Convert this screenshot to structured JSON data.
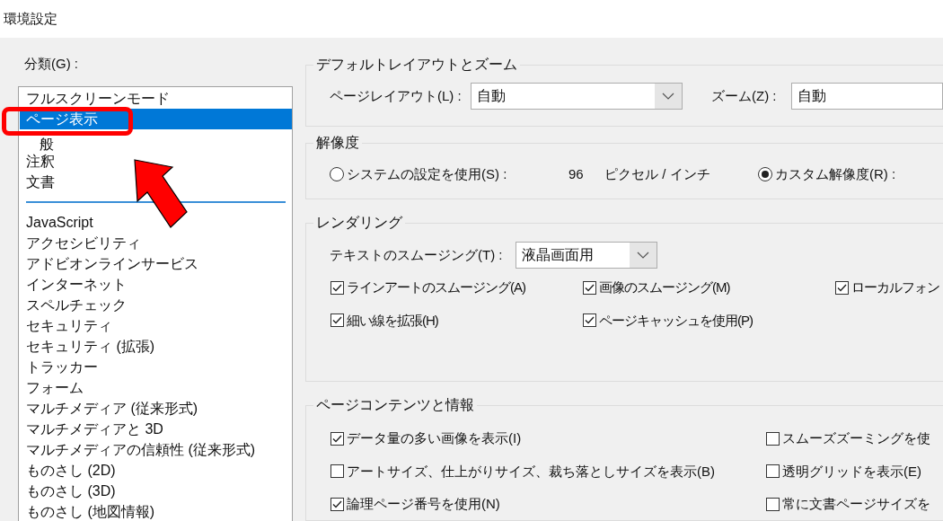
{
  "window": {
    "title": "環境設定"
  },
  "categories": {
    "label": "分類(G) :",
    "primary_items": [
      {
        "label": "フルスクリーンモード",
        "selected": false
      },
      {
        "label": "ページ表示",
        "selected": true
      },
      {
        "label": "般",
        "selected": false
      },
      {
        "label": "注釈",
        "selected": false
      },
      {
        "label": "文書",
        "selected": false
      }
    ],
    "secondary_items": [
      {
        "label": "JavaScript",
        "selected": false
      },
      {
        "label": "アクセシビリティ",
        "selected": false
      },
      {
        "label": "アドビオンラインサービス",
        "selected": false
      },
      {
        "label": "インターネット",
        "selected": false
      },
      {
        "label": "スペルチェック",
        "selected": false
      },
      {
        "label": "セキュリティ",
        "selected": false
      },
      {
        "label": "セキュリティ (拡張)",
        "selected": false
      },
      {
        "label": "トラッカー",
        "selected": false
      },
      {
        "label": "フォーム",
        "selected": false
      },
      {
        "label": "マルチメディア (従来形式)",
        "selected": false
      },
      {
        "label": "マルチメディアと 3D",
        "selected": false
      },
      {
        "label": "マルチメディアの信頼性 (従来形式)",
        "selected": false
      },
      {
        "label": "ものさし (2D)",
        "selected": false
      },
      {
        "label": "ものさし (3D)",
        "selected": false
      },
      {
        "label": "ものさし (地図情報)",
        "selected": false
      }
    ]
  },
  "layout_zoom": {
    "title": "デフォルトレイアウトとズーム",
    "page_layout": {
      "label": "ページレイアウト(L) :",
      "value": "自動"
    },
    "zoom": {
      "label": "ズーム(Z) :",
      "value": "自動"
    }
  },
  "resolution": {
    "title": "解像度",
    "system": {
      "label": "システムの設定を使用(S) :",
      "selected": false
    },
    "system_value": "96",
    "system_unit": "ピクセル / インチ",
    "custom": {
      "label": "カスタム解像度(R) :",
      "selected": true
    }
  },
  "rendering": {
    "title": "レンダリング",
    "text_smoothing": {
      "label": "テキストのスムージング(T) :",
      "value": "液晶画面用"
    },
    "checkboxes": [
      {
        "label": "ラインアートのスムージング(A)",
        "checked": true
      },
      {
        "label": "画像のスムージング(M)",
        "checked": true
      },
      {
        "label": "ローカルフォン",
        "checked": true
      },
      {
        "label": "細い線を拡張(H)",
        "checked": true
      },
      {
        "label": "ページキャッシュを使用(P)",
        "checked": true
      }
    ]
  },
  "page_content": {
    "title": "ページコンテンツと情報",
    "checkboxes": [
      {
        "label": "データ量の多い画像を表示(I)",
        "checked": true
      },
      {
        "label": "スムーズズーミングを使",
        "checked": false
      },
      {
        "label": "アートサイズ、仕上がりサイズ、裁ち落としサイズを表示(B)",
        "checked": false
      },
      {
        "label": "透明グリッドを表示(E)",
        "checked": false
      },
      {
        "label": "論理ページ番号を使用(N)",
        "checked": true
      },
      {
        "label": "常に文書ページサイズを",
        "checked": false
      }
    ]
  }
}
